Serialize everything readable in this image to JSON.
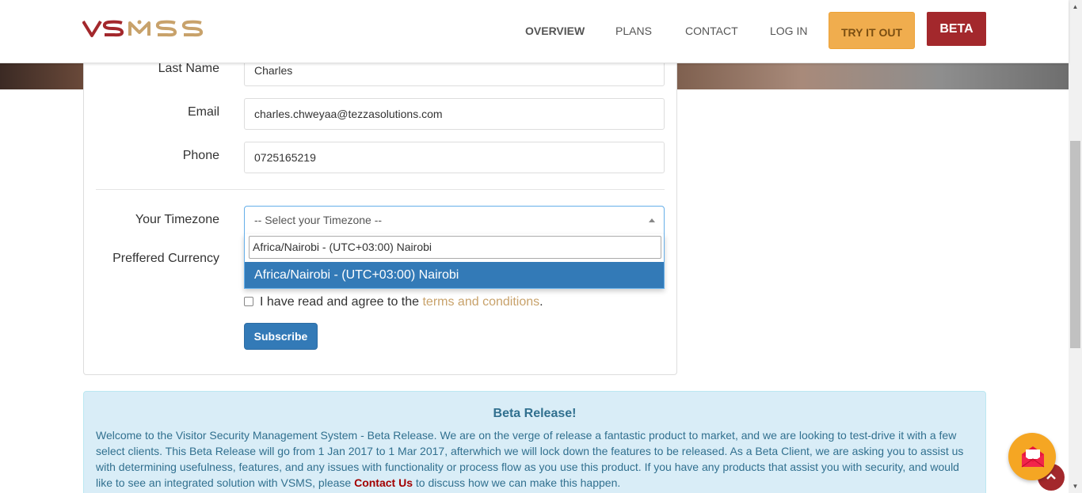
{
  "header": {
    "logo_text": "VSMS",
    "nav": [
      {
        "label": "OVERVIEW"
      },
      {
        "label": "PLANS"
      },
      {
        "label": "CONTACT"
      },
      {
        "label": "LOG IN"
      }
    ],
    "try_label": "TRY IT OUT",
    "beta_label": "BETA"
  },
  "form": {
    "last_name_label": "Last Name",
    "last_name_value": "Charles",
    "email_label": "Email",
    "email_value": "charles.chweyaa@tezzasolutions.com",
    "phone_label": "Phone",
    "phone_value": "0725165219",
    "timezone_label": "Your Timezone",
    "timezone_placeholder": "-- Select your Timezone --",
    "timezone_search_value": "Africa/Nairobi - (UTC+03:00) Nairobi",
    "timezone_option": "Africa/Nairobi - (UTC+03:00) Nairobi",
    "currency_label": "Preffered Currency",
    "agree_text": "I have read and agree to the ",
    "terms_link": "terms and conditions",
    "agree_suffix": ".",
    "subscribe_label": "Subscribe"
  },
  "beta_box": {
    "title": "Beta Release!",
    "text_before": "Welcome to the Visitor Security Management System - Beta Release. We are on the verge of release a fantastic product to market, and we are looking to test-drive it with a few select clients. This Beta Release will go from 1 Jan 2017 to 1 Mar 2017, afterwhich we will lock down the features to be released. As a Beta Client, we are asking you to assist us with determining usefulness, features, and any issues with functionality or process flow as you use this product. If you have any products that assist you with security, and would like to see an integrated solution with VSMS, please ",
    "contact_link": "Contact Us",
    "text_after": " to discuss how we can make this happen."
  },
  "colors": {
    "logo_red": "#a3282c",
    "logo_gold": "#c8a26b",
    "try_button": "#f0ad4e",
    "beta_button": "#a3282c",
    "primary": "#337ab7",
    "alert_bg": "#d9edf7",
    "mail_fab": "#f5a623"
  },
  "icons": {
    "mail": "mail-icon",
    "scroll_top": "chevron-up-icon"
  }
}
